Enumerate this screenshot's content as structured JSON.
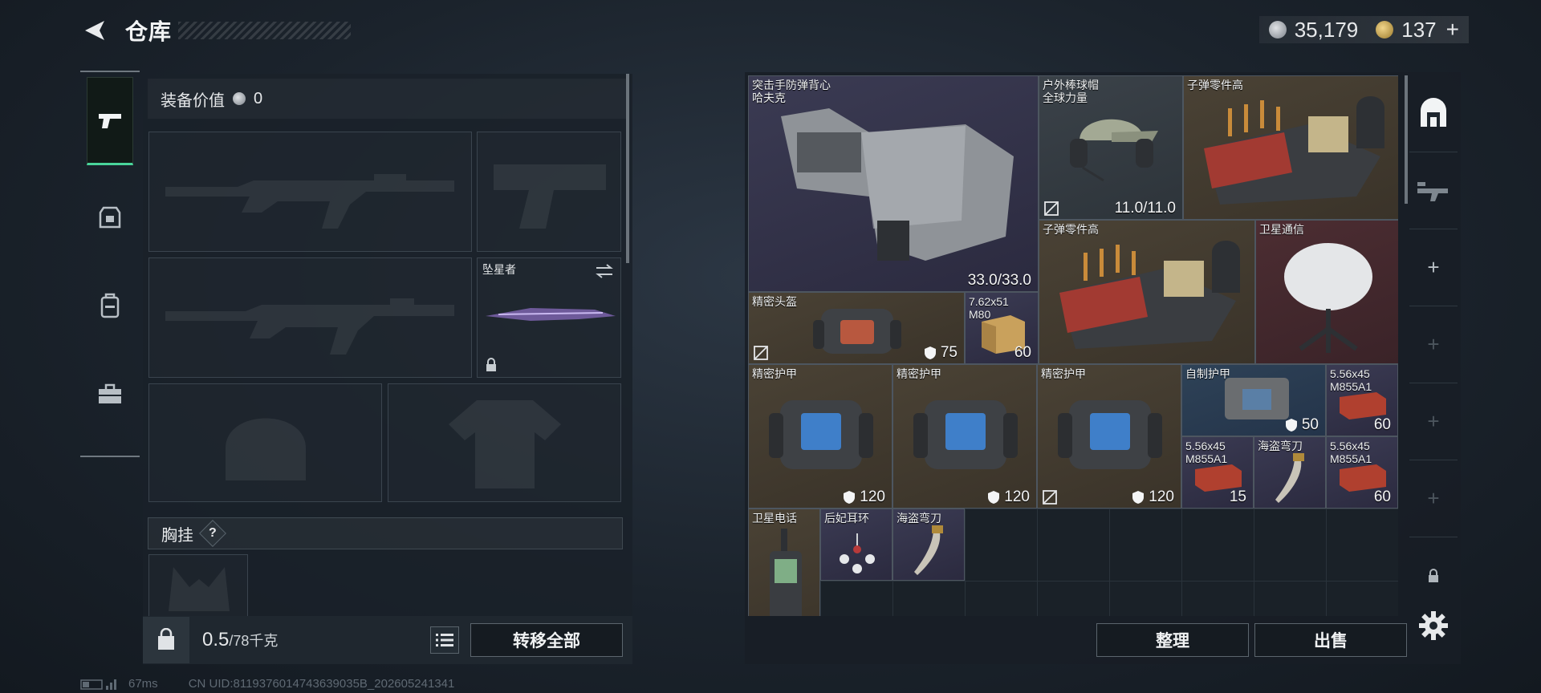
{
  "header": {
    "title": "仓库"
  },
  "currency": {
    "silver": "35,179",
    "gold": "137",
    "plus": "+"
  },
  "rail": [
    "weapons-icon",
    "armor-icon",
    "backpack-icon",
    "toolbox-icon"
  ],
  "loadout": {
    "equip_value_label": "装备价值",
    "equip_value": "0",
    "melee_name": "坠星者",
    "chest_label": "胸挂",
    "chest_hint": "?",
    "weight_current": "0.5",
    "weight_max": "/78千克",
    "transfer_all": "转移全部"
  },
  "stash": {
    "items": [
      {
        "name": "突击手防弹背心\n哈夫克",
        "value": "33.0/33.0",
        "tier": "purple"
      },
      {
        "name": "户外棒球帽\n全球力量",
        "value": "11.0/11.0",
        "tier": "gray"
      },
      {
        "name": "子弹零件高",
        "value": "",
        "tier": "gold"
      },
      {
        "name": "子弹零件高",
        "value": "",
        "tier": "gold"
      },
      {
        "name": "卫星通信",
        "value": "",
        "tier": "red"
      },
      {
        "name": "精密头盔",
        "value": "75",
        "tier": "gold"
      },
      {
        "name": "7.62x51\nM80",
        "value": "60",
        "tier": "purple"
      },
      {
        "name": "精密护甲",
        "value": "120",
        "tier": "gold"
      },
      {
        "name": "精密护甲",
        "value": "120",
        "tier": "gold"
      },
      {
        "name": "精密护甲",
        "value": "120",
        "tier": "gold"
      },
      {
        "name": "自制护甲",
        "value": "50",
        "tier": "blue"
      },
      {
        "name": "5.56x45\nM855A1",
        "value": "60",
        "tier": "purple"
      },
      {
        "name": "5.56x45\nM855A1",
        "value": "15",
        "tier": "purple"
      },
      {
        "name": "海盗弯刀",
        "value": "",
        "tier": "purple"
      },
      {
        "name": "5.56x45\nM855A1",
        "value": "60",
        "tier": "purple"
      },
      {
        "name": "卫星电话",
        "value": "",
        "tier": "gold"
      },
      {
        "name": "后妃耳环",
        "value": "",
        "tier": "purple"
      },
      {
        "name": "海盗弯刀",
        "value": "",
        "tier": "purple"
      }
    ],
    "organize": "整理",
    "sell": "出售"
  },
  "status": {
    "ping": "67ms",
    "uid": "CN UID:8119376014743639035B_202605241341"
  },
  "colors": {
    "accent": "#49d49a",
    "purple": "#3b3b53",
    "gold": "#4a4235",
    "red": "#4c2d32",
    "blue": "#2e4257"
  }
}
